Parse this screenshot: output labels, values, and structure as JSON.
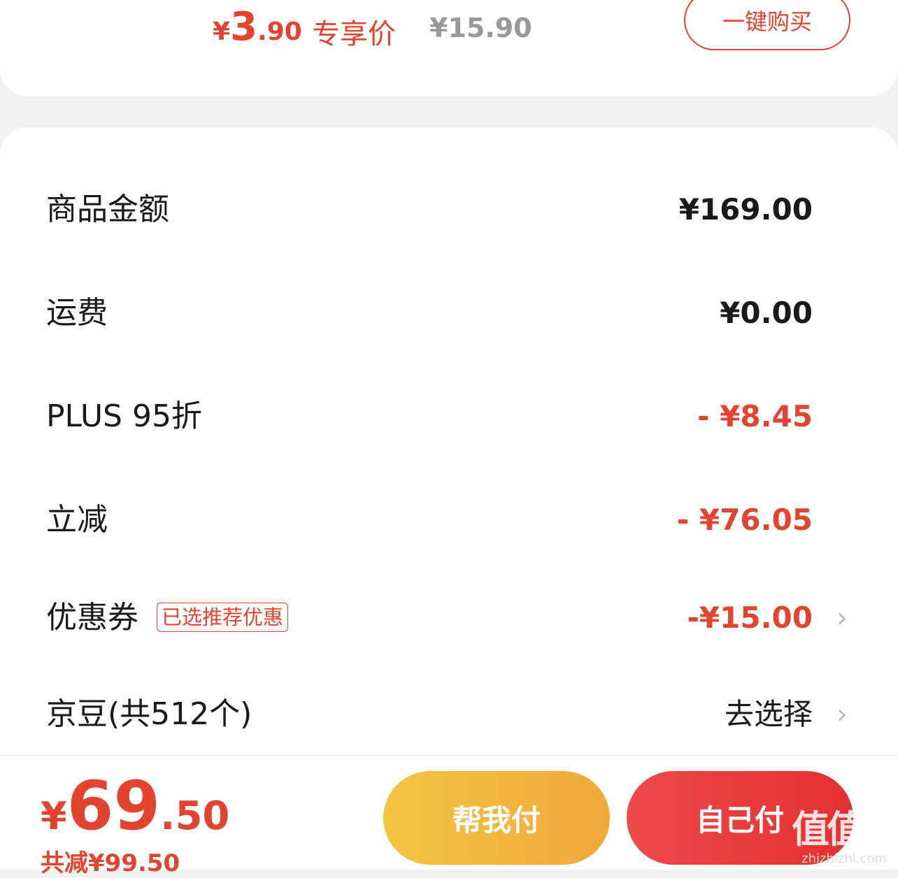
{
  "product": {
    "price_symbol": "¥",
    "price_int": "3",
    "price_dec": ".90",
    "exclusive_label": "专享价",
    "original_price": "¥15.90",
    "buy_button": "一键购买"
  },
  "summary": {
    "goods_amount": {
      "label": "商品金额",
      "value": "¥169.00"
    },
    "shipping": {
      "label": "运费",
      "value": "¥0.00"
    },
    "plus_discount": {
      "label": "PLUS 95折",
      "value": "- ¥8.45"
    },
    "instant_reduction": {
      "label": "立减",
      "value": "- ¥76.05"
    },
    "coupon": {
      "label": "优惠券",
      "badge": "已选推荐优惠",
      "value": "-¥15.00"
    },
    "jingdou": {
      "label": "京豆(共512个)",
      "value": "去选择"
    }
  },
  "bottom": {
    "total_symbol": "¥",
    "total_int": "69",
    "total_dec": ".50",
    "saved": "共减¥99.50",
    "help_pay": "帮我付",
    "self_pay": "自己付"
  },
  "watermark": {
    "logo": "值值值",
    "site": "zhizhizhi.com"
  },
  "colors": {
    "accent_red": "#e2442f",
    "help_button": "#f2b63f",
    "self_button": "#e83a3a"
  },
  "icons": {
    "row_arrow": "chevron-right-icon"
  }
}
